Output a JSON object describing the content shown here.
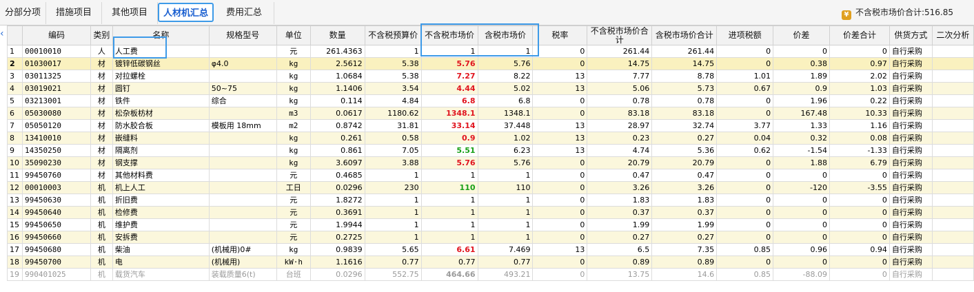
{
  "tabs": [
    {
      "label": "分部分项",
      "active": false
    },
    {
      "label": "措施项目",
      "active": false
    },
    {
      "label": "其他项目",
      "active": false
    },
    {
      "label": "人材机汇总",
      "active": true
    },
    {
      "label": "费用汇总",
      "active": false
    }
  ],
  "total": {
    "icon": "coin-icon",
    "label": "不含税市场价合计:516.85"
  },
  "colors": {
    "accent": "#3d9ae8",
    "highlight_red": "#e0141e",
    "highlight_green": "#18a018",
    "row_tint": "#fbf7dc"
  },
  "columns": [
    "",
    "编码",
    "类别",
    "名称",
    "规格型号",
    "单位",
    "数量",
    "不含税预算价",
    "不含税市场价",
    "含税市场价",
    "税率",
    "不含税市场价合计",
    "含税市场价合计",
    "进项税额",
    "价差",
    "价差合计",
    "供货方式",
    "二次分析"
  ],
  "rows": [
    {
      "cells": [
        "1",
        "00010010",
        "人",
        "人工费",
        "",
        "元",
        "261.4363",
        "1",
        "1",
        "1",
        "0",
        "261.44",
        "261.44",
        "0",
        "0",
        "0",
        "自行采购",
        ""
      ],
      "market_style": "plain"
    },
    {
      "cells": [
        "2",
        "01030017",
        "材",
        "镀锌低碳钢丝",
        "φ4.0",
        "kg",
        "2.5612",
        "5.38",
        "5.76",
        "5.76",
        "0",
        "14.75",
        "14.75",
        "0",
        "0.38",
        "0.97",
        "自行采购",
        ""
      ],
      "market_style": "red"
    },
    {
      "cells": [
        "3",
        "03011325",
        "材",
        "对拉螺栓",
        "",
        "kg",
        "1.0684",
        "5.38",
        "7.27",
        "8.22",
        "13",
        "7.77",
        "8.78",
        "1.01",
        "1.89",
        "2.02",
        "自行采购",
        ""
      ],
      "market_style": "red"
    },
    {
      "cells": [
        "4",
        "03019021",
        "材",
        "圆钉",
        "50~75",
        "kg",
        "1.1406",
        "3.54",
        "4.44",
        "5.02",
        "13",
        "5.06",
        "5.73",
        "0.67",
        "0.9",
        "1.03",
        "自行采购",
        ""
      ],
      "market_style": "red"
    },
    {
      "cells": [
        "5",
        "03213001",
        "材",
        "铁件",
        "综合",
        "kg",
        "0.114",
        "4.84",
        "6.8",
        "6.8",
        "0",
        "0.78",
        "0.78",
        "0",
        "1.96",
        "0.22",
        "自行采购",
        ""
      ],
      "market_style": "red"
    },
    {
      "cells": [
        "6",
        "05030080",
        "材",
        "松杂板枋材",
        "",
        "m3",
        "0.0617",
        "1180.62",
        "1348.1",
        "1348.1",
        "0",
        "83.18",
        "83.18",
        "0",
        "167.48",
        "10.33",
        "自行采购",
        ""
      ],
      "market_style": "red"
    },
    {
      "cells": [
        "7",
        "05050120",
        "材",
        "防水胶合板",
        "模板用 18mm",
        "m2",
        "0.8742",
        "31.81",
        "33.14",
        "37.448",
        "13",
        "28.97",
        "32.74",
        "3.77",
        "1.33",
        "1.16",
        "自行采购",
        ""
      ],
      "market_style": "red"
    },
    {
      "cells": [
        "8",
        "13410010",
        "材",
        "嵌缝料",
        "",
        "kg",
        "0.261",
        "0.58",
        "0.9",
        "1.02",
        "13",
        "0.23",
        "0.27",
        "0.04",
        "0.32",
        "0.08",
        "自行采购",
        ""
      ],
      "market_style": "red"
    },
    {
      "cells": [
        "9",
        "14350250",
        "材",
        "隔离剂",
        "",
        "kg",
        "0.861",
        "7.05",
        "5.51",
        "6.23",
        "13",
        "4.74",
        "5.36",
        "0.62",
        "-1.54",
        "-1.33",
        "自行采购",
        ""
      ],
      "market_style": "green"
    },
    {
      "cells": [
        "10",
        "35090230",
        "材",
        "钢支撑",
        "",
        "kg",
        "3.6097",
        "3.88",
        "5.76",
        "5.76",
        "0",
        "20.79",
        "20.79",
        "0",
        "1.88",
        "6.79",
        "自行采购",
        ""
      ],
      "market_style": "red"
    },
    {
      "cells": [
        "11",
        "99450760",
        "材",
        "其他材料费",
        "",
        "元",
        "0.4685",
        "1",
        "1",
        "1",
        "0",
        "0.47",
        "0.47",
        "0",
        "0",
        "0",
        "自行采购",
        ""
      ],
      "market_style": "plain"
    },
    {
      "cells": [
        "12",
        "00010003",
        "机",
        "机上人工",
        "",
        "工日",
        "0.0296",
        "230",
        "110",
        "110",
        "0",
        "3.26",
        "3.26",
        "0",
        "-120",
        "-3.55",
        "自行采购",
        ""
      ],
      "market_style": "green"
    },
    {
      "cells": [
        "13",
        "99450630",
        "机",
        "折旧费",
        "",
        "元",
        "1.8272",
        "1",
        "1",
        "1",
        "0",
        "1.83",
        "1.83",
        "0",
        "0",
        "0",
        "自行采购",
        ""
      ],
      "market_style": "plain"
    },
    {
      "cells": [
        "14",
        "99450640",
        "机",
        "检修费",
        "",
        "元",
        "0.3691",
        "1",
        "1",
        "1",
        "0",
        "0.37",
        "0.37",
        "0",
        "0",
        "0",
        "自行采购",
        ""
      ],
      "market_style": "plain"
    },
    {
      "cells": [
        "15",
        "99450650",
        "机",
        "维护费",
        "",
        "元",
        "1.9944",
        "1",
        "1",
        "1",
        "0",
        "1.99",
        "1.99",
        "0",
        "0",
        "0",
        "自行采购",
        ""
      ],
      "market_style": "plain"
    },
    {
      "cells": [
        "16",
        "99450660",
        "机",
        "安拆费",
        "",
        "元",
        "0.2725",
        "1",
        "1",
        "1",
        "0",
        "0.27",
        "0.27",
        "0",
        "0",
        "0",
        "自行采购",
        ""
      ],
      "market_style": "plain"
    },
    {
      "cells": [
        "17",
        "99450680",
        "机",
        "柴油",
        "(机械用)0#",
        "kg",
        "0.9839",
        "5.65",
        "6.61",
        "7.469",
        "13",
        "6.5",
        "7.35",
        "0.85",
        "0.96",
        "0.94",
        "自行采购",
        ""
      ],
      "market_style": "red"
    },
    {
      "cells": [
        "18",
        "99450700",
        "机",
        "电",
        "(机械用)",
        "kW·h",
        "1.1616",
        "0.77",
        "0.77",
        "0.77",
        "0",
        "0.89",
        "0.89",
        "0",
        "0",
        "0",
        "自行采购",
        ""
      ],
      "market_style": "plain"
    },
    {
      "cells": [
        "19",
        "990401025",
        "机",
        "载货汽车",
        "装载质量6(t)",
        "台班",
        "0.0296",
        "552.75",
        "464.66",
        "493.21",
        "0",
        "13.75",
        "14.6",
        "0.85",
        "-88.09",
        "0",
        "自行采购",
        ""
      ],
      "market_style": "green",
      "dim": true
    }
  ]
}
